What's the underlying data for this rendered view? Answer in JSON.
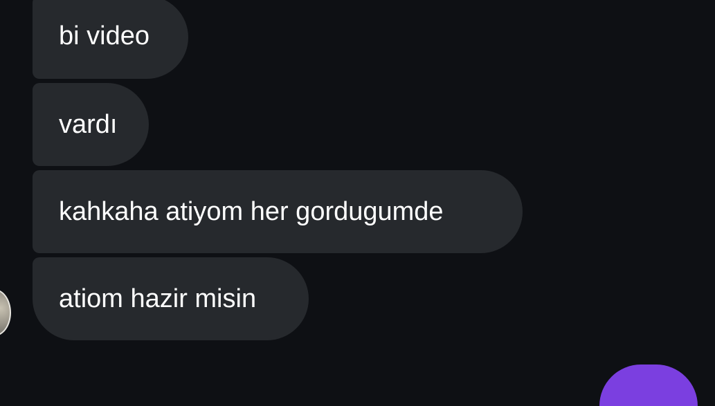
{
  "messages": [
    {
      "text": "bi video"
    },
    {
      "text": "vardı"
    },
    {
      "text": "kahkaha atiyom her gordugumde"
    },
    {
      "text": "atiom hazir misin"
    }
  ],
  "colors": {
    "background": "#0e1014",
    "incoming_bubble": "#26292d",
    "outgoing_bubble": "#7b3fe0",
    "text": "#ffffff"
  }
}
